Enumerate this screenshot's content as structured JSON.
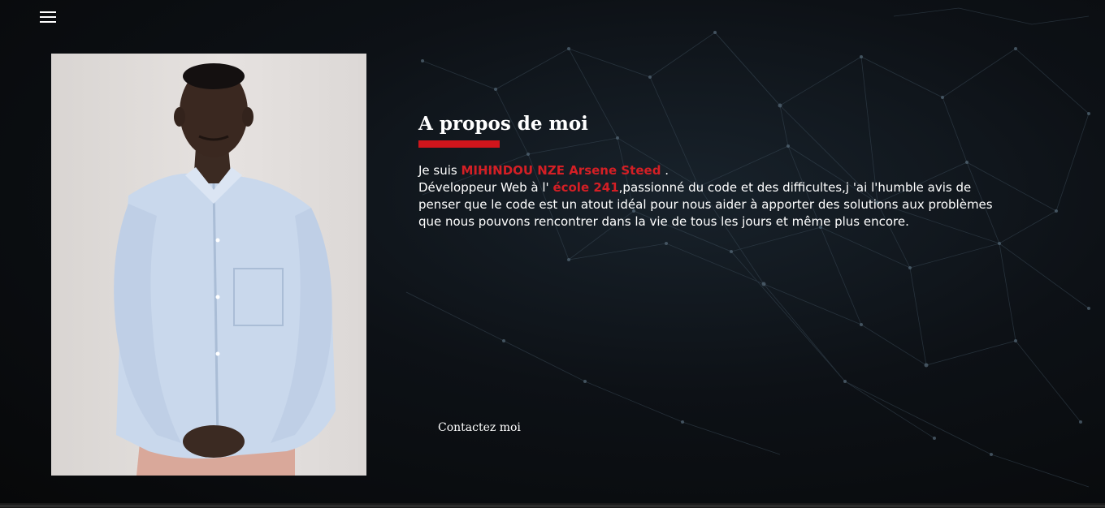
{
  "nav": {
    "menu_icon": "hamburger-menu-icon"
  },
  "profile": {
    "photo_description_icon": "portrait-photo"
  },
  "about": {
    "title": "A propos de moi",
    "intro_prefix": "Je suis ",
    "name": "MIHINDOU NZE Arsene Steed",
    "intro_suffix": " .",
    "role_prefix": "Développeur Web à l' ",
    "school": "école 241",
    "role_suffix": ",passionné du code et des difficultes,j 'ai l'humble avis de penser que le code est un atout idéal pour nous aider à apporter des solutions aux problèmes que nous pouvons rencontrer dans la vie de tous les jours et même plus encore."
  },
  "contact": {
    "label": "Contactez moi"
  },
  "colors": {
    "accent": "#d0151c",
    "text": "#ffffff",
    "background": "#0b0c0e"
  }
}
